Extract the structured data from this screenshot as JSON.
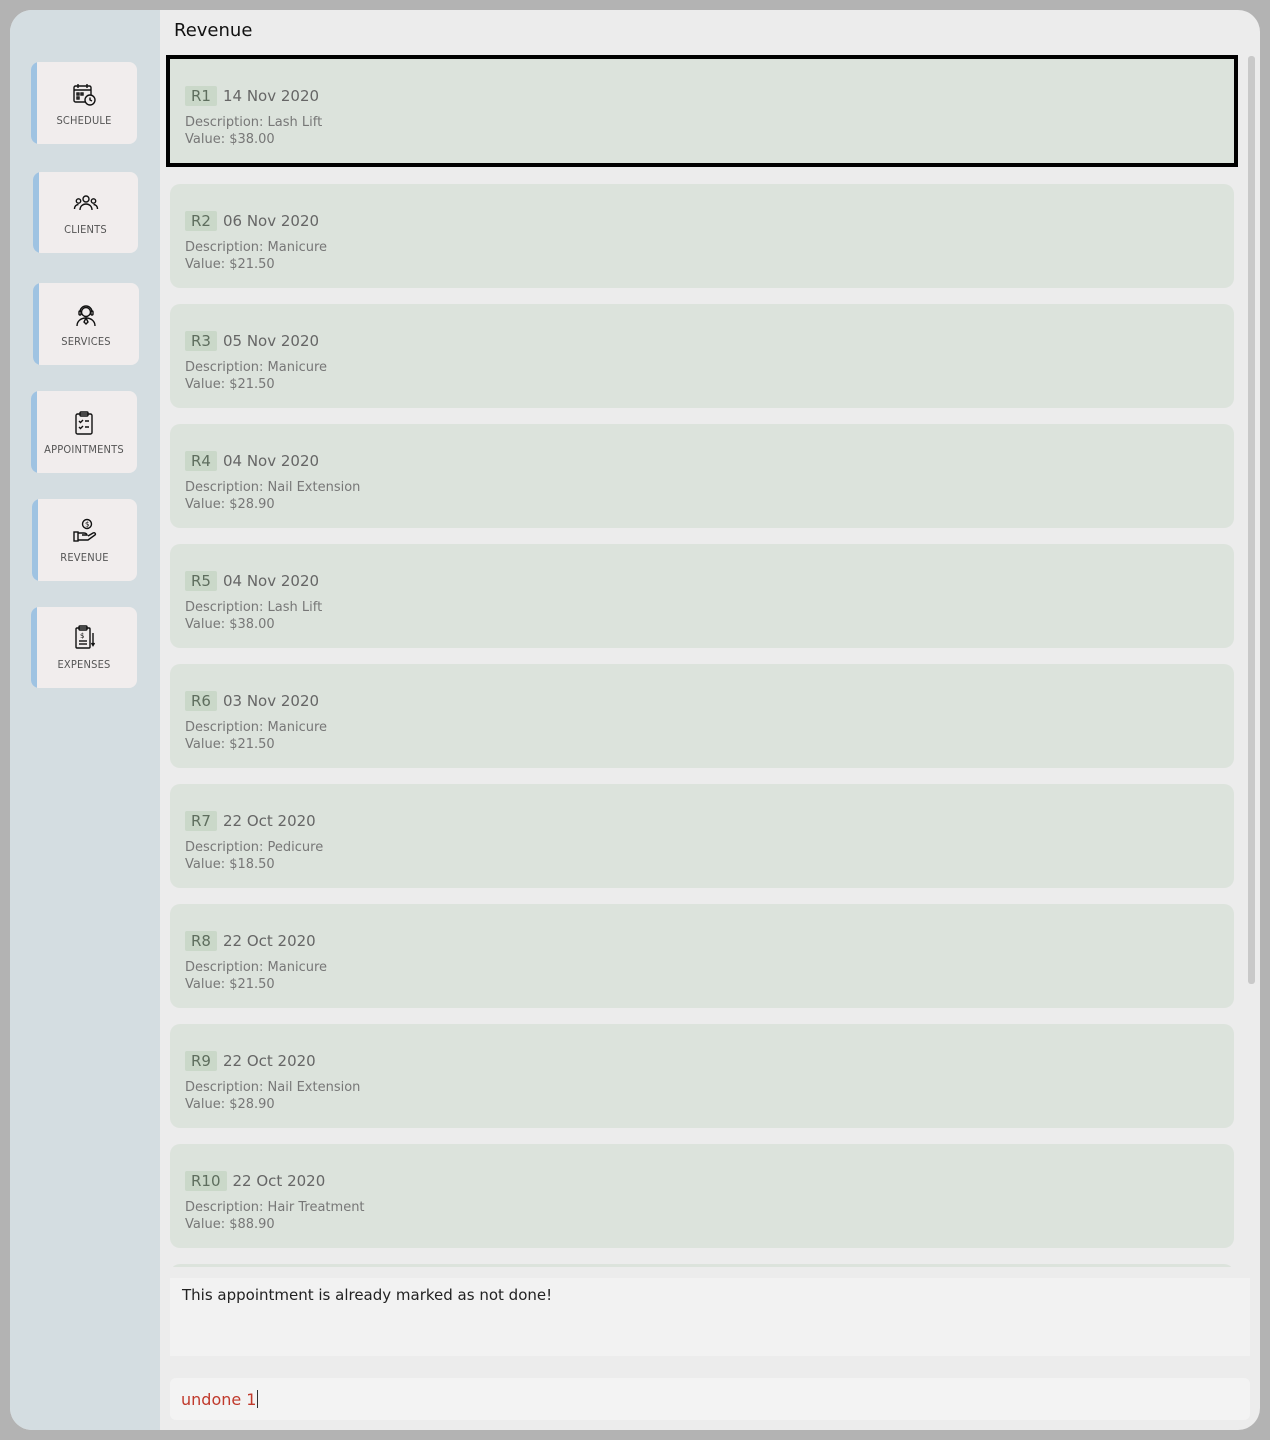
{
  "sidebar": {
    "items": [
      {
        "label": "SCHEDULE",
        "icon": "calendar-clock-icon"
      },
      {
        "label": "CLIENTS",
        "icon": "people-icon"
      },
      {
        "label": "SERVICES",
        "icon": "person-headset-icon"
      },
      {
        "label": "APPOINTMENTS",
        "icon": "clipboard-check-icon"
      },
      {
        "label": "REVENUE",
        "icon": "hand-coin-icon"
      },
      {
        "label": "EXPENSES",
        "icon": "receipt-icon"
      }
    ],
    "accent": "#9fc3e2"
  },
  "main": {
    "title": "Revenue",
    "revenues": [
      {
        "id": "R1",
        "date": "14 Nov 2020",
        "description": "Description: Lash Lift",
        "value": "Value: $38.00"
      },
      {
        "id": "R2",
        "date": "06 Nov 2020",
        "description": "Description: Manicure",
        "value": "Value: $21.50"
      },
      {
        "id": "R3",
        "date": "05 Nov 2020",
        "description": "Description: Manicure",
        "value": "Value: $21.50"
      },
      {
        "id": "R4",
        "date": "04 Nov 2020",
        "description": "Description: Nail Extension",
        "value": "Value: $28.90"
      },
      {
        "id": "R5",
        "date": "04 Nov 2020",
        "description": "Description: Lash Lift",
        "value": "Value: $38.00"
      },
      {
        "id": "R6",
        "date": "03 Nov 2020",
        "description": "Description: Manicure",
        "value": "Value: $21.50"
      },
      {
        "id": "R7",
        "date": "22 Oct 2020",
        "description": "Description: Pedicure",
        "value": "Value: $18.50"
      },
      {
        "id": "R8",
        "date": "22 Oct 2020",
        "description": "Description: Manicure",
        "value": "Value: $21.50"
      },
      {
        "id": "R9",
        "date": "22 Oct 2020",
        "description": "Description: Nail Extension",
        "value": "Value: $28.90"
      },
      {
        "id": "R10",
        "date": "22 Oct 2020",
        "description": "Description: Hair Treatment",
        "value": "Value: $88.90"
      }
    ]
  },
  "result_display": {
    "text": "This appointment is already marked as not done!"
  },
  "command_box": {
    "value": "undone 1",
    "text_color": "#c0392b"
  }
}
